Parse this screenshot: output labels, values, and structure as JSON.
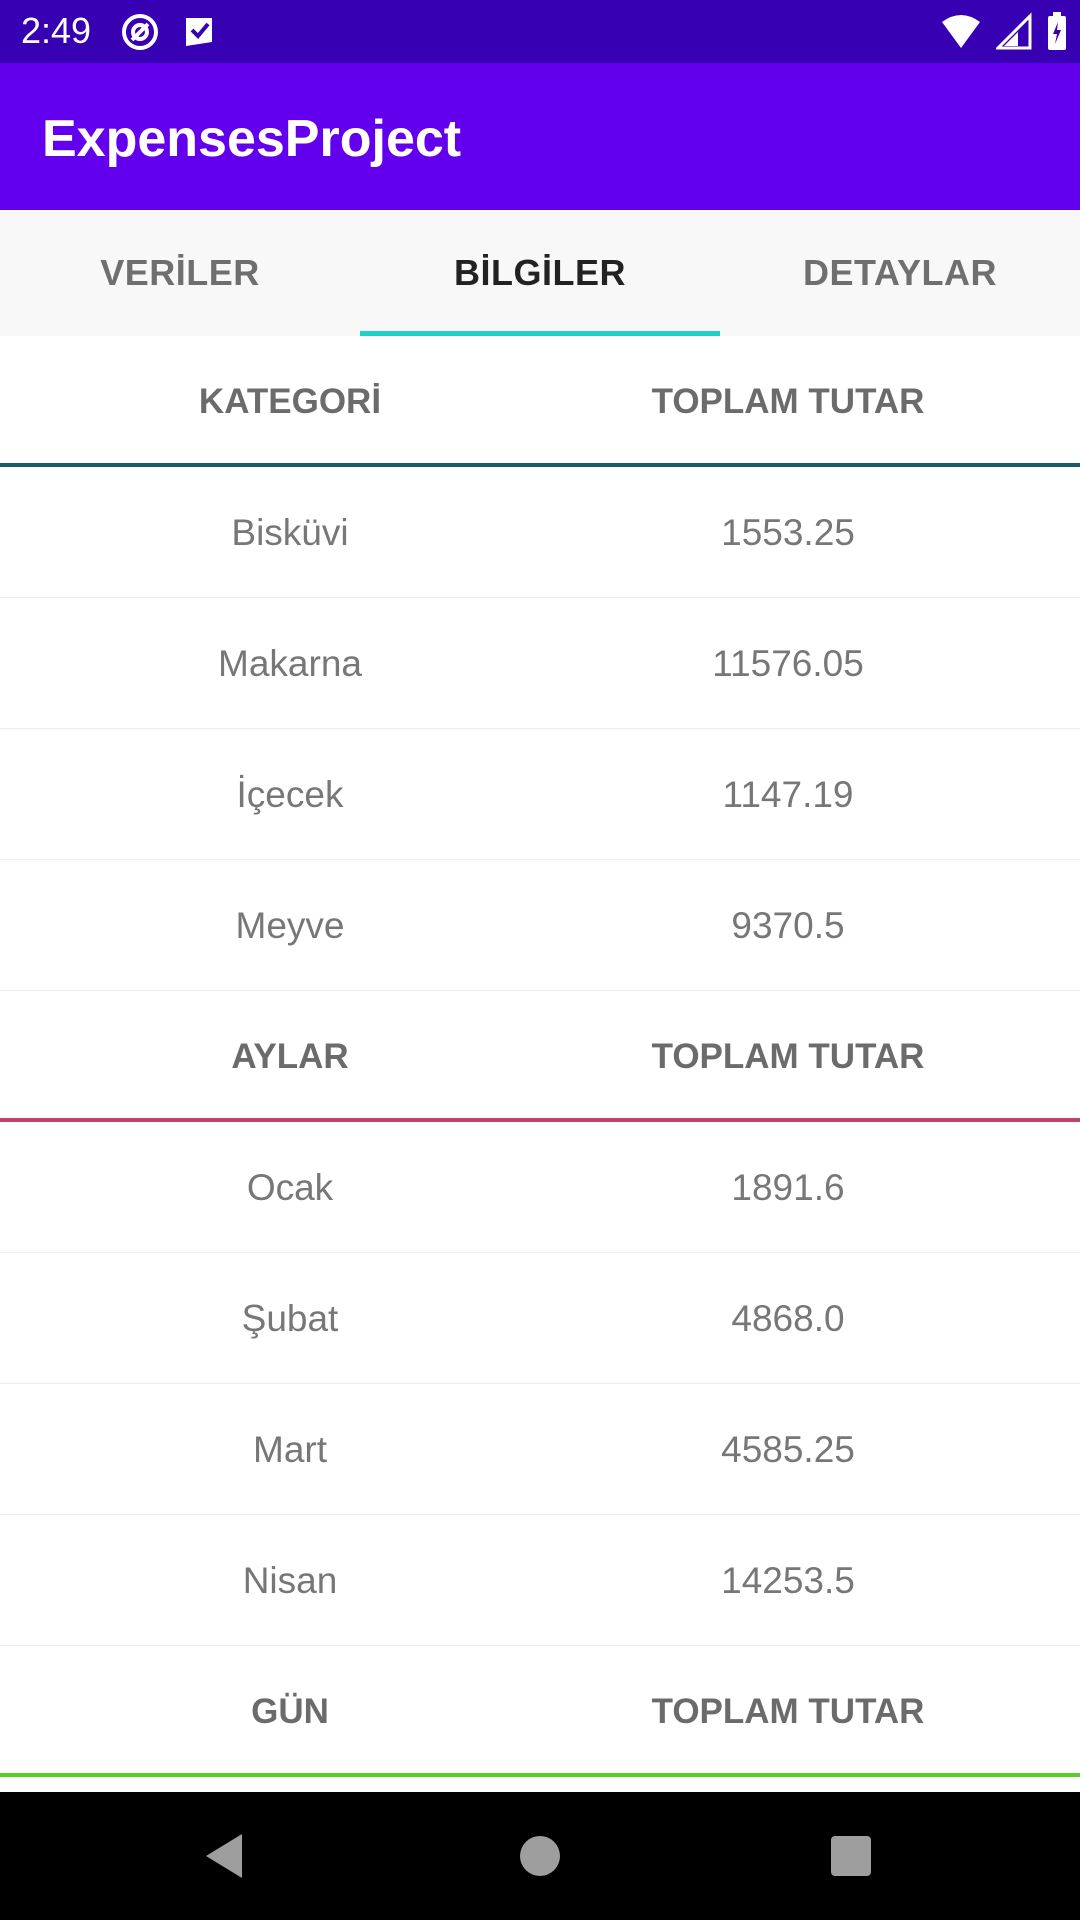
{
  "status_bar": {
    "time": "2:49",
    "left_icons": [
      "at-sign-icon",
      "play-protect-icon"
    ],
    "right_icons": [
      "wifi-icon",
      "signal-icon",
      "battery-icon"
    ]
  },
  "app_bar": {
    "title": "ExpensesProject",
    "color": "#6200ee"
  },
  "tabs": [
    {
      "label": "VERİLER",
      "active": false
    },
    {
      "label": "BİLGİLER",
      "active": true
    },
    {
      "label": "DETAYLAR",
      "active": false
    }
  ],
  "sections": [
    {
      "header": [
        "KATEGORİ",
        "TOPLAM TUTAR"
      ],
      "accent": "#155d69",
      "rows": [
        [
          "Bisküvi",
          "1553.25"
        ],
        [
          "Makarna",
          "11576.05"
        ],
        [
          "İçecek",
          "1147.19"
        ],
        [
          "Meyve",
          "9370.5"
        ]
      ]
    },
    {
      "header": [
        "AYLAR",
        "TOPLAM TUTAR"
      ],
      "accent": "#c5426a",
      "rows": [
        [
          "Ocak",
          "1891.6"
        ],
        [
          "Şubat",
          "4868.0"
        ],
        [
          "Mart",
          "4585.25"
        ],
        [
          "Nisan",
          "14253.5"
        ]
      ]
    },
    {
      "header": [
        "GÜN",
        "TOPLAM TUTAR"
      ],
      "accent": "#56d12a",
      "rows": []
    }
  ],
  "nav_bar": {
    "buttons": [
      "back-icon",
      "home-icon",
      "recents-icon"
    ]
  }
}
